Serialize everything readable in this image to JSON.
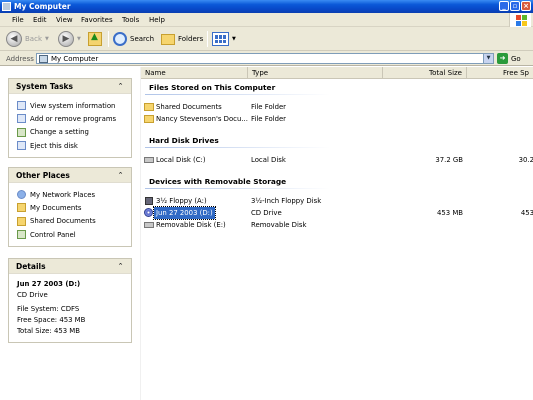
{
  "window": {
    "title": "My Computer"
  },
  "menu": [
    "File",
    "Edit",
    "View",
    "Favorites",
    "Tools",
    "Help"
  ],
  "toolbar": {
    "back": "Back",
    "search": "Search",
    "folders": "Folders"
  },
  "address": {
    "label": "Address",
    "value": "My Computer",
    "go": "Go"
  },
  "system_tasks": {
    "title": "System Tasks",
    "items": [
      "View system information",
      "Add or remove programs",
      "Change a setting",
      "Eject this disk"
    ]
  },
  "other_places": {
    "title": "Other Places",
    "items": [
      "My Network Places",
      "My Documents",
      "Shared Documents",
      "Control Panel"
    ]
  },
  "details": {
    "title": "Details",
    "name": "Jun 27 2003 (D:)",
    "type": "CD Drive",
    "filesystem": "File System: CDFS",
    "free": "Free Space: 453 MB",
    "total": "Total Size: 453 MB"
  },
  "columns": {
    "name": "Name",
    "type": "Type",
    "total": "Total Size",
    "free": "Free Sp"
  },
  "groups": {
    "files": {
      "title": "Files Stored on This Computer",
      "rows": [
        {
          "name": "Shared Documents",
          "type": "File Folder",
          "total": "",
          "free": ""
        },
        {
          "name": "Nancy  Stevenson's Docu...",
          "type": "File Folder",
          "total": "",
          "free": ""
        }
      ]
    },
    "hdd": {
      "title": "Hard Disk Drives",
      "rows": [
        {
          "name": "Local Disk (C:)",
          "type": "Local Disk",
          "total": "37.2 GB",
          "free": "30.2"
        }
      ]
    },
    "removable": {
      "title": "Devices with Removable Storage",
      "rows": [
        {
          "name": "3½ Floppy (A:)",
          "type": "3½-Inch Floppy Disk",
          "total": "",
          "free": ""
        },
        {
          "name": "Jun 27 2003 (D:)",
          "type": "CD Drive",
          "total": "453 MB",
          "free": "453"
        },
        {
          "name": "Removable Disk (E:)",
          "type": "Removable Disk",
          "total": "",
          "free": ""
        }
      ]
    }
  }
}
